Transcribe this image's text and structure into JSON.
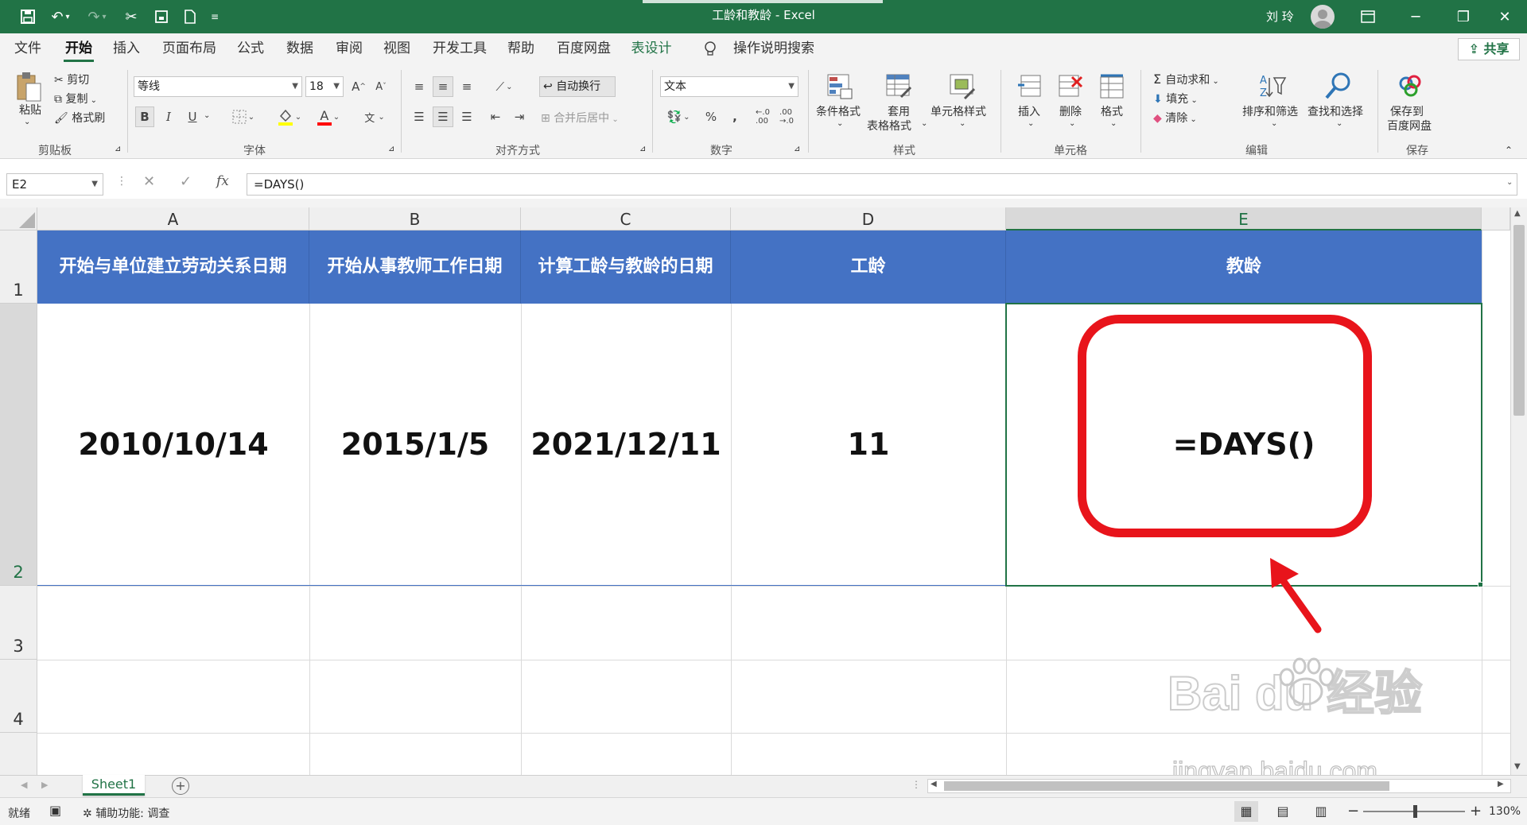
{
  "window": {
    "title": "工龄和教龄  -  Excel",
    "user": "刘 玲",
    "colors": {
      "brand": "#217346",
      "header_fill": "#4472c4",
      "annotation": "#e8141b"
    }
  },
  "tabs": [
    {
      "label": "文件"
    },
    {
      "label": "开始"
    },
    {
      "label": "插入"
    },
    {
      "label": "页面布局"
    },
    {
      "label": "公式"
    },
    {
      "label": "数据"
    },
    {
      "label": "审阅"
    },
    {
      "label": "视图"
    },
    {
      "label": "开发工具"
    },
    {
      "label": "帮助"
    },
    {
      "label": "百度网盘"
    },
    {
      "label": "表设计"
    }
  ],
  "search_label": "操作说明搜索",
  "share_label": "共享",
  "ribbon": {
    "clipboard": {
      "paste": "粘贴",
      "cut": "剪切",
      "copy": "复制",
      "format_painter": "格式刷",
      "group": "剪贴板"
    },
    "font": {
      "name": "等线",
      "size": "18",
      "bold": "B",
      "italic": "I",
      "underline": "U",
      "color_letter": "A",
      "phonetic": "文",
      "group": "字体"
    },
    "alignment": {
      "wrap": "自动换行",
      "merge": "合并后居中",
      "group": "对齐方式"
    },
    "number": {
      "format": "文本",
      "percent": "%",
      "comma": ",",
      "group": "数字"
    },
    "styles": {
      "conditional": "条件格式",
      "table_1": "套用",
      "table_2": "表格格式",
      "cell_styles": "单元格样式",
      "group": "样式"
    },
    "cells": {
      "insert": "插入",
      "delete": "删除",
      "format": "格式",
      "group": "单元格"
    },
    "editing": {
      "autosum": "自动求和",
      "fill": "填充",
      "clear": "清除",
      "sort_filter": "排序和筛选",
      "find_select": "查找和选择",
      "group": "编辑"
    },
    "save": {
      "label_1": "保存到",
      "label_2": "百度网盘",
      "group": "保存"
    }
  },
  "formula_bar": {
    "name_box": "E2",
    "formula": "=DAYS()"
  },
  "columns": [
    "A",
    "B",
    "C",
    "D",
    "E"
  ],
  "rows": [
    "1",
    "2",
    "3",
    "4"
  ],
  "table": {
    "headers": [
      "开始与单位建立劳动关系日期",
      "开始从事教师工作日期",
      "计算工龄与教龄的日期",
      "工龄",
      "教龄"
    ],
    "row2": [
      "2010/10/14",
      "2015/1/5",
      "2021/12/11",
      "11",
      "=DAYS()"
    ]
  },
  "sheets": [
    {
      "label": "Sheet1"
    }
  ],
  "status": {
    "ready": "就绪",
    "accessibility": "辅助功能: 调查",
    "zoom": "130%"
  },
  "watermark": {
    "brand": "Bai du 经验",
    "url": "jingyan.baidu.com"
  }
}
